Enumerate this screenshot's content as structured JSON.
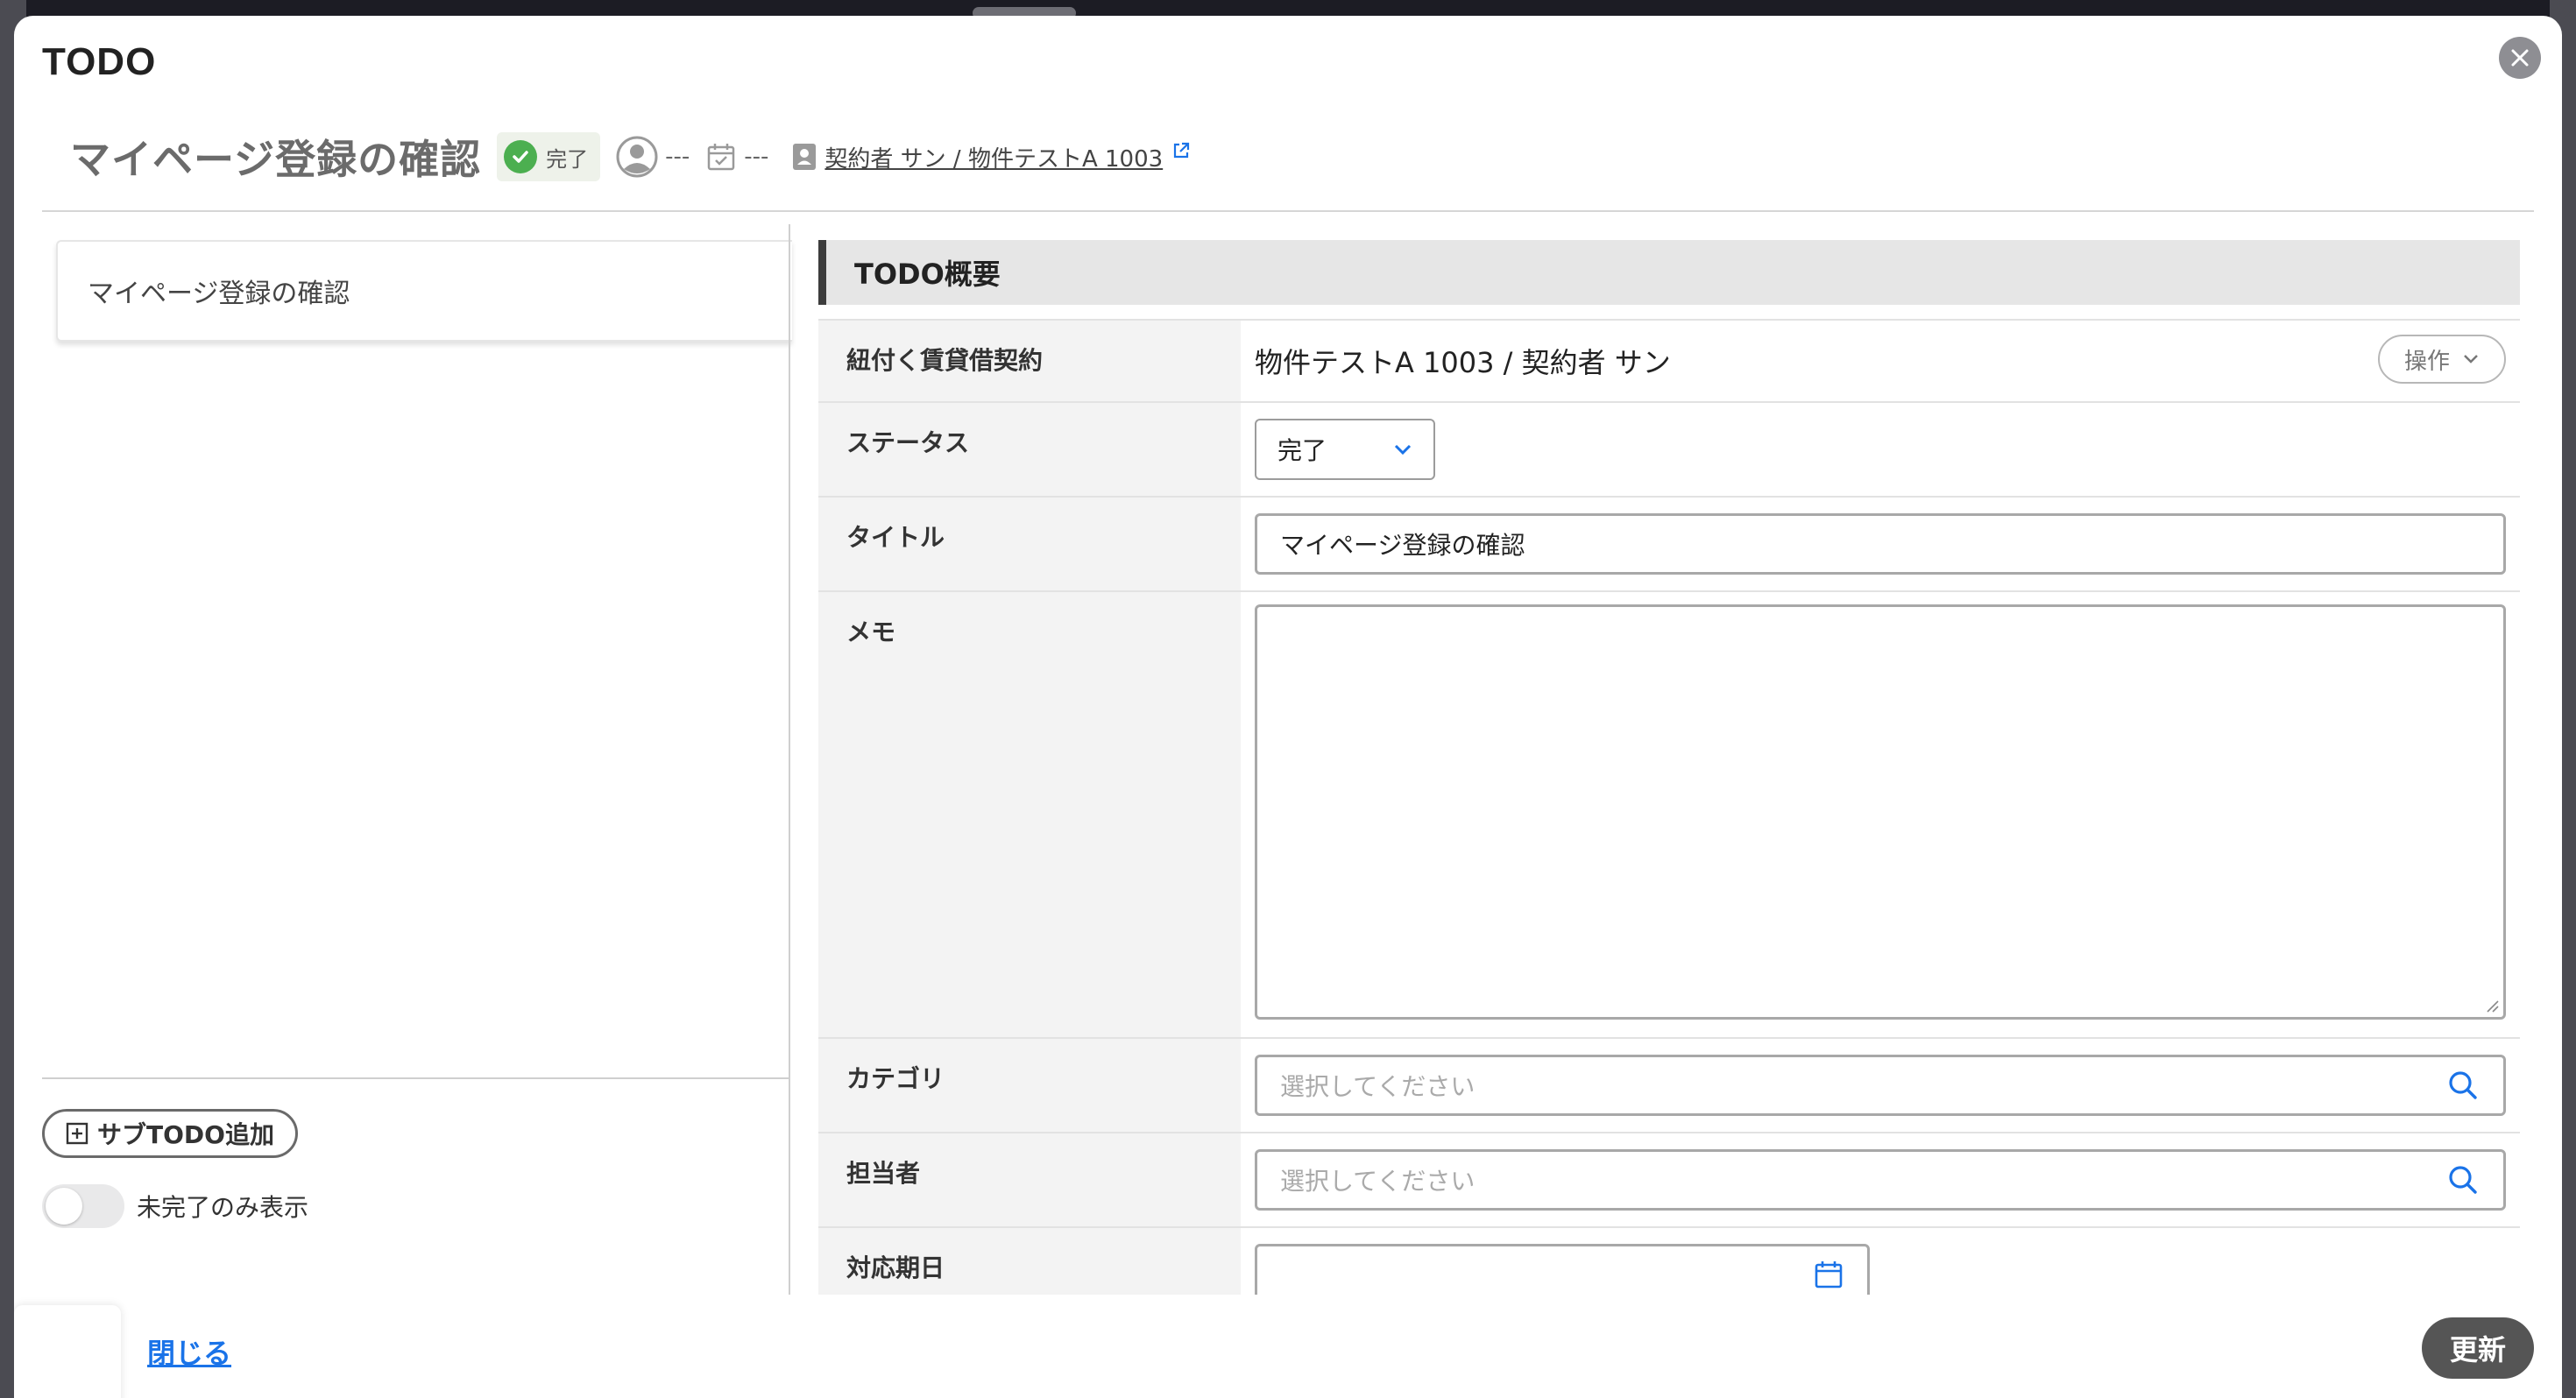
{
  "modal": {
    "title": "TODO",
    "close_icon": "close-icon"
  },
  "header": {
    "todo_title": "マイページ登録の確認",
    "status_label": "完了",
    "assignee": "---",
    "due_date": "---",
    "contract_link": "契約者 サン / 物件テストA 1003"
  },
  "left_panel": {
    "tree_item": "マイページ登録の確認",
    "add_sub_todo": "サブTODO追加",
    "toggle_label": "未完了のみ表示"
  },
  "section": {
    "title": "TODO概要"
  },
  "form": {
    "contract_label": "紐付く賃貸借契約",
    "contract_value": "物件テストA 1003 / 契約者 サン",
    "operation_button": "操作",
    "status_label": "ステータス",
    "status_value": "完了",
    "title_label": "タイトル",
    "title_value": "マイページ登録の確認",
    "memo_label": "メモ",
    "category_label": "カテゴリ",
    "category_placeholder": "選択してください",
    "assignee_label": "担当者",
    "assignee_placeholder": "選択してください",
    "due_label": "対応期日"
  },
  "footer": {
    "close_link": "閉じる",
    "update_button": "更新"
  },
  "colors": {
    "status_green": "#4caf50",
    "link_blue": "#1a73e8",
    "primary_dark": "#555555"
  }
}
